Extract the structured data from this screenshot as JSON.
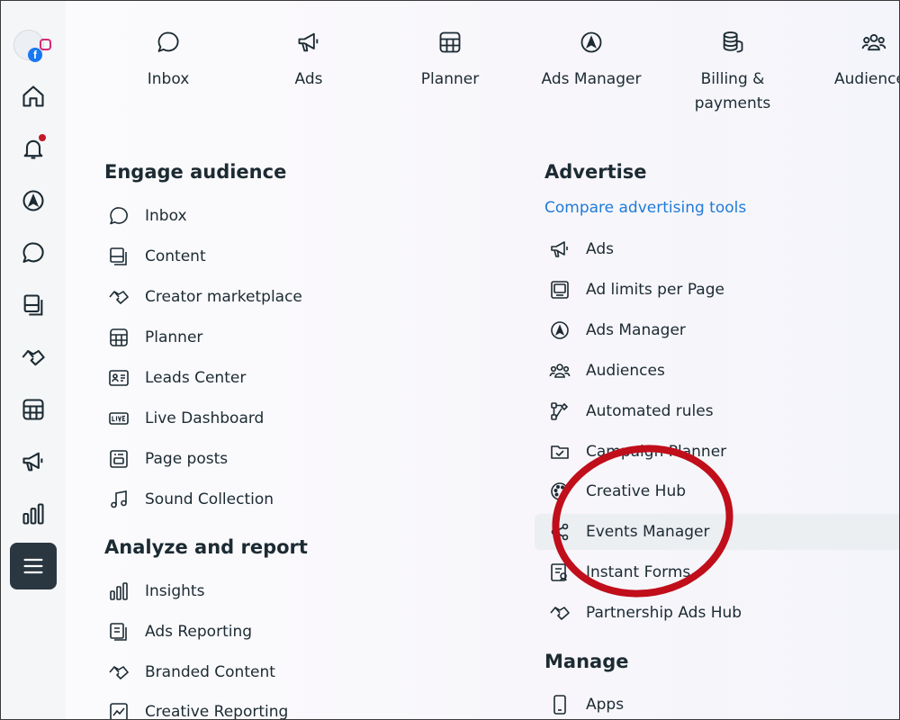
{
  "shortcuts": [
    {
      "label": "Inbox",
      "icon": "chat-bubble-icon"
    },
    {
      "label": "Ads",
      "icon": "megaphone-icon"
    },
    {
      "label": "Planner",
      "icon": "calendar-grid-icon"
    },
    {
      "label": "Ads Manager",
      "icon": "ads-manager-icon"
    },
    {
      "label": "Billing & payments",
      "icon": "coins-stack-icon"
    },
    {
      "label": "Audience",
      "icon": "people-group-icon"
    }
  ],
  "engage": {
    "title": "Engage audience",
    "items": [
      {
        "label": "Inbox"
      },
      {
        "label": "Content"
      },
      {
        "label": "Creator marketplace"
      },
      {
        "label": "Planner"
      },
      {
        "label": "Leads Center"
      },
      {
        "label": "Live Dashboard"
      },
      {
        "label": "Page posts"
      },
      {
        "label": "Sound Collection"
      }
    ]
  },
  "analyze": {
    "title": "Analyze and report",
    "items": [
      {
        "label": "Insights"
      },
      {
        "label": "Ads Reporting"
      },
      {
        "label": "Branded Content"
      },
      {
        "label": "Creative Reporting"
      }
    ]
  },
  "advertise": {
    "title": "Advertise",
    "compare_link": "Compare advertising tools",
    "items": [
      {
        "label": "Ads"
      },
      {
        "label": "Ad limits per Page"
      },
      {
        "label": "Ads Manager"
      },
      {
        "label": "Audiences"
      },
      {
        "label": "Automated rules"
      },
      {
        "label": "Campaign Planner"
      },
      {
        "label": "Creative Hub"
      },
      {
        "label": "Events Manager"
      },
      {
        "label": "Instant Forms"
      },
      {
        "label": "Partnership Ads Hub"
      }
    ]
  },
  "manage": {
    "title": "Manage",
    "items": [
      {
        "label": "Apps"
      }
    ]
  },
  "brand": {
    "fb_letter": "f"
  },
  "colors": {
    "link": "#1f7bd8",
    "annotation": "#c00e1a",
    "active_rail": "#2a3741",
    "notification": "#c4182a"
  }
}
